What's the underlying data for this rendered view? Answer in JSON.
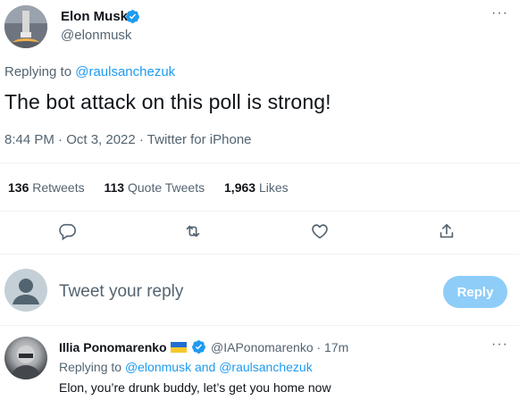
{
  "tweet": {
    "author_name": "Elon Musk",
    "author_handle": "@elonmusk",
    "replying_label": "Replying to",
    "replying_to": "@raulsanchezuk",
    "text": "The bot attack on this poll is strong!",
    "meta": "8:44 PM · Oct 3, 2022 · Twitter for iPhone",
    "stats": {
      "retweets_count": "136",
      "retweets_label": "Retweets",
      "quotes_count": "113",
      "quotes_label": "Quote Tweets",
      "likes_count": "1,963",
      "likes_label": "Likes"
    },
    "actions": [
      "reply-icon",
      "retweet-icon",
      "like-icon",
      "share-icon"
    ],
    "more": "···"
  },
  "composer": {
    "placeholder": "Tweet your reply",
    "reply_button": "Reply"
  },
  "reply": {
    "author_name": "Illia Ponomarenko",
    "author_handle": "@IAPonomarenko",
    "time": "· 17m",
    "replying_label": "Replying to",
    "replying_to_1": "@elonmusk",
    "replying_and": "and",
    "replying_to_2": "@raulsanchezuk",
    "text": "Elon, you’re drunk buddy, let’s get you home now",
    "more": "···"
  },
  "colors": {
    "accent": "#1d9bf0",
    "muted": "#536471",
    "reply_button_bg": "#8ecdf8"
  }
}
